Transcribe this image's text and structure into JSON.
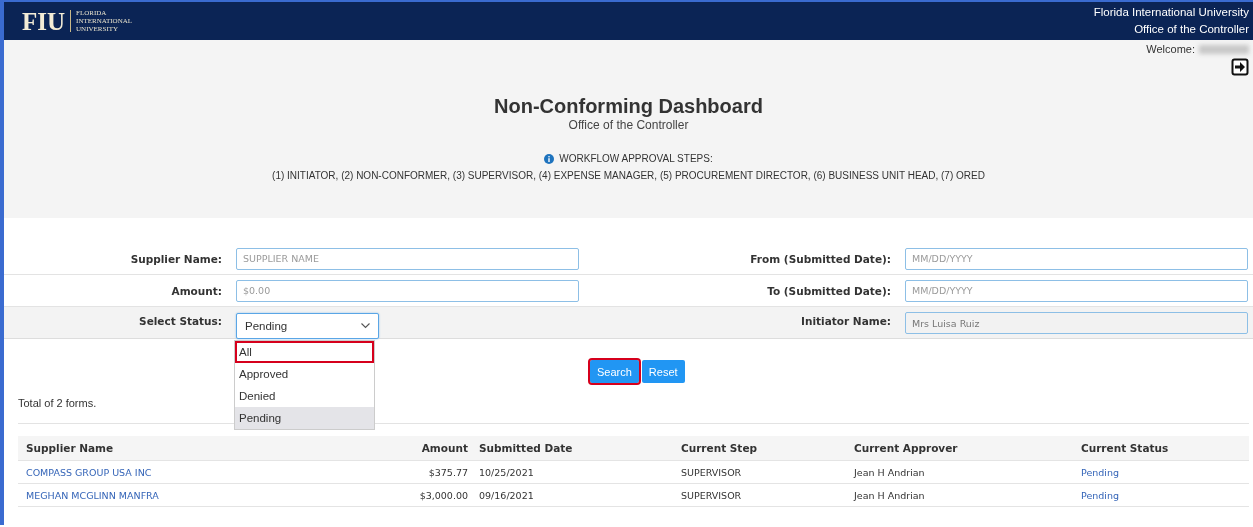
{
  "header": {
    "logo_mark": "FIU",
    "logo_lines": [
      "FLORIDA",
      "INTERNATIONAL",
      "UNIVERSITY"
    ],
    "org": "Florida International University",
    "office": "Office of the Controller"
  },
  "welcome": "Welcome:",
  "title": "Non-Conforming Dashboard",
  "subtitle": "Office of the Controller",
  "workflow_heading": "WORKFLOW APPROVAL STEPS:",
  "workflow_steps": "(1) INITIATOR, (2) NON-CONFORMER, (3) SUPERVISOR, (4) EXPENSE MANAGER, (5) PROCUREMENT DIRECTOR, (6) BUSINESS UNIT HEAD, (7) ORED",
  "filters_left": [
    {
      "label": "Supplier Name:",
      "placeholder": "SUPPLIER NAME"
    },
    {
      "label": "Amount:",
      "placeholder": "$0.00"
    }
  ],
  "status": {
    "label": "Select Status:",
    "value": "Pending",
    "expanded": true,
    "options": [
      {
        "label": "All",
        "selected": false,
        "highlighted": true
      },
      {
        "label": "Approved",
        "selected": false,
        "highlighted": false
      },
      {
        "label": "Denied",
        "selected": false,
        "highlighted": false
      },
      {
        "label": "Pending",
        "selected": true,
        "highlighted": false
      }
    ]
  },
  "filters_right": [
    {
      "label": "From (Submitted Date):",
      "placeholder": "MM/DD/YYYY"
    },
    {
      "label": "To (Submitted Date):",
      "placeholder": "MM/DD/YYYY"
    }
  ],
  "initiator": {
    "label": "Initiator Name:",
    "value": "Mrs Luisa Ruiz",
    "disabled": true
  },
  "buttons": [
    {
      "label": "Search",
      "highlighted": true
    },
    {
      "label": "Reset",
      "highlighted": false
    }
  ],
  "total": "Total of 2 forms.",
  "table": {
    "columns": [
      "Supplier Name",
      "Amount",
      "Submitted Date",
      "Current Step",
      "Current Approver",
      "Current Status"
    ],
    "rows": [
      [
        "COMPASS GROUP USA INC",
        "$375.77",
        "10/25/2021",
        "SUPERVISOR",
        "Jean H Andrian",
        "Pending"
      ],
      [
        "MEGHAN MCGLINN MANFRA",
        "$3,000.00",
        "09/16/2021",
        "SUPERVISOR",
        "Jean H Andrian",
        "Pending"
      ]
    ]
  }
}
